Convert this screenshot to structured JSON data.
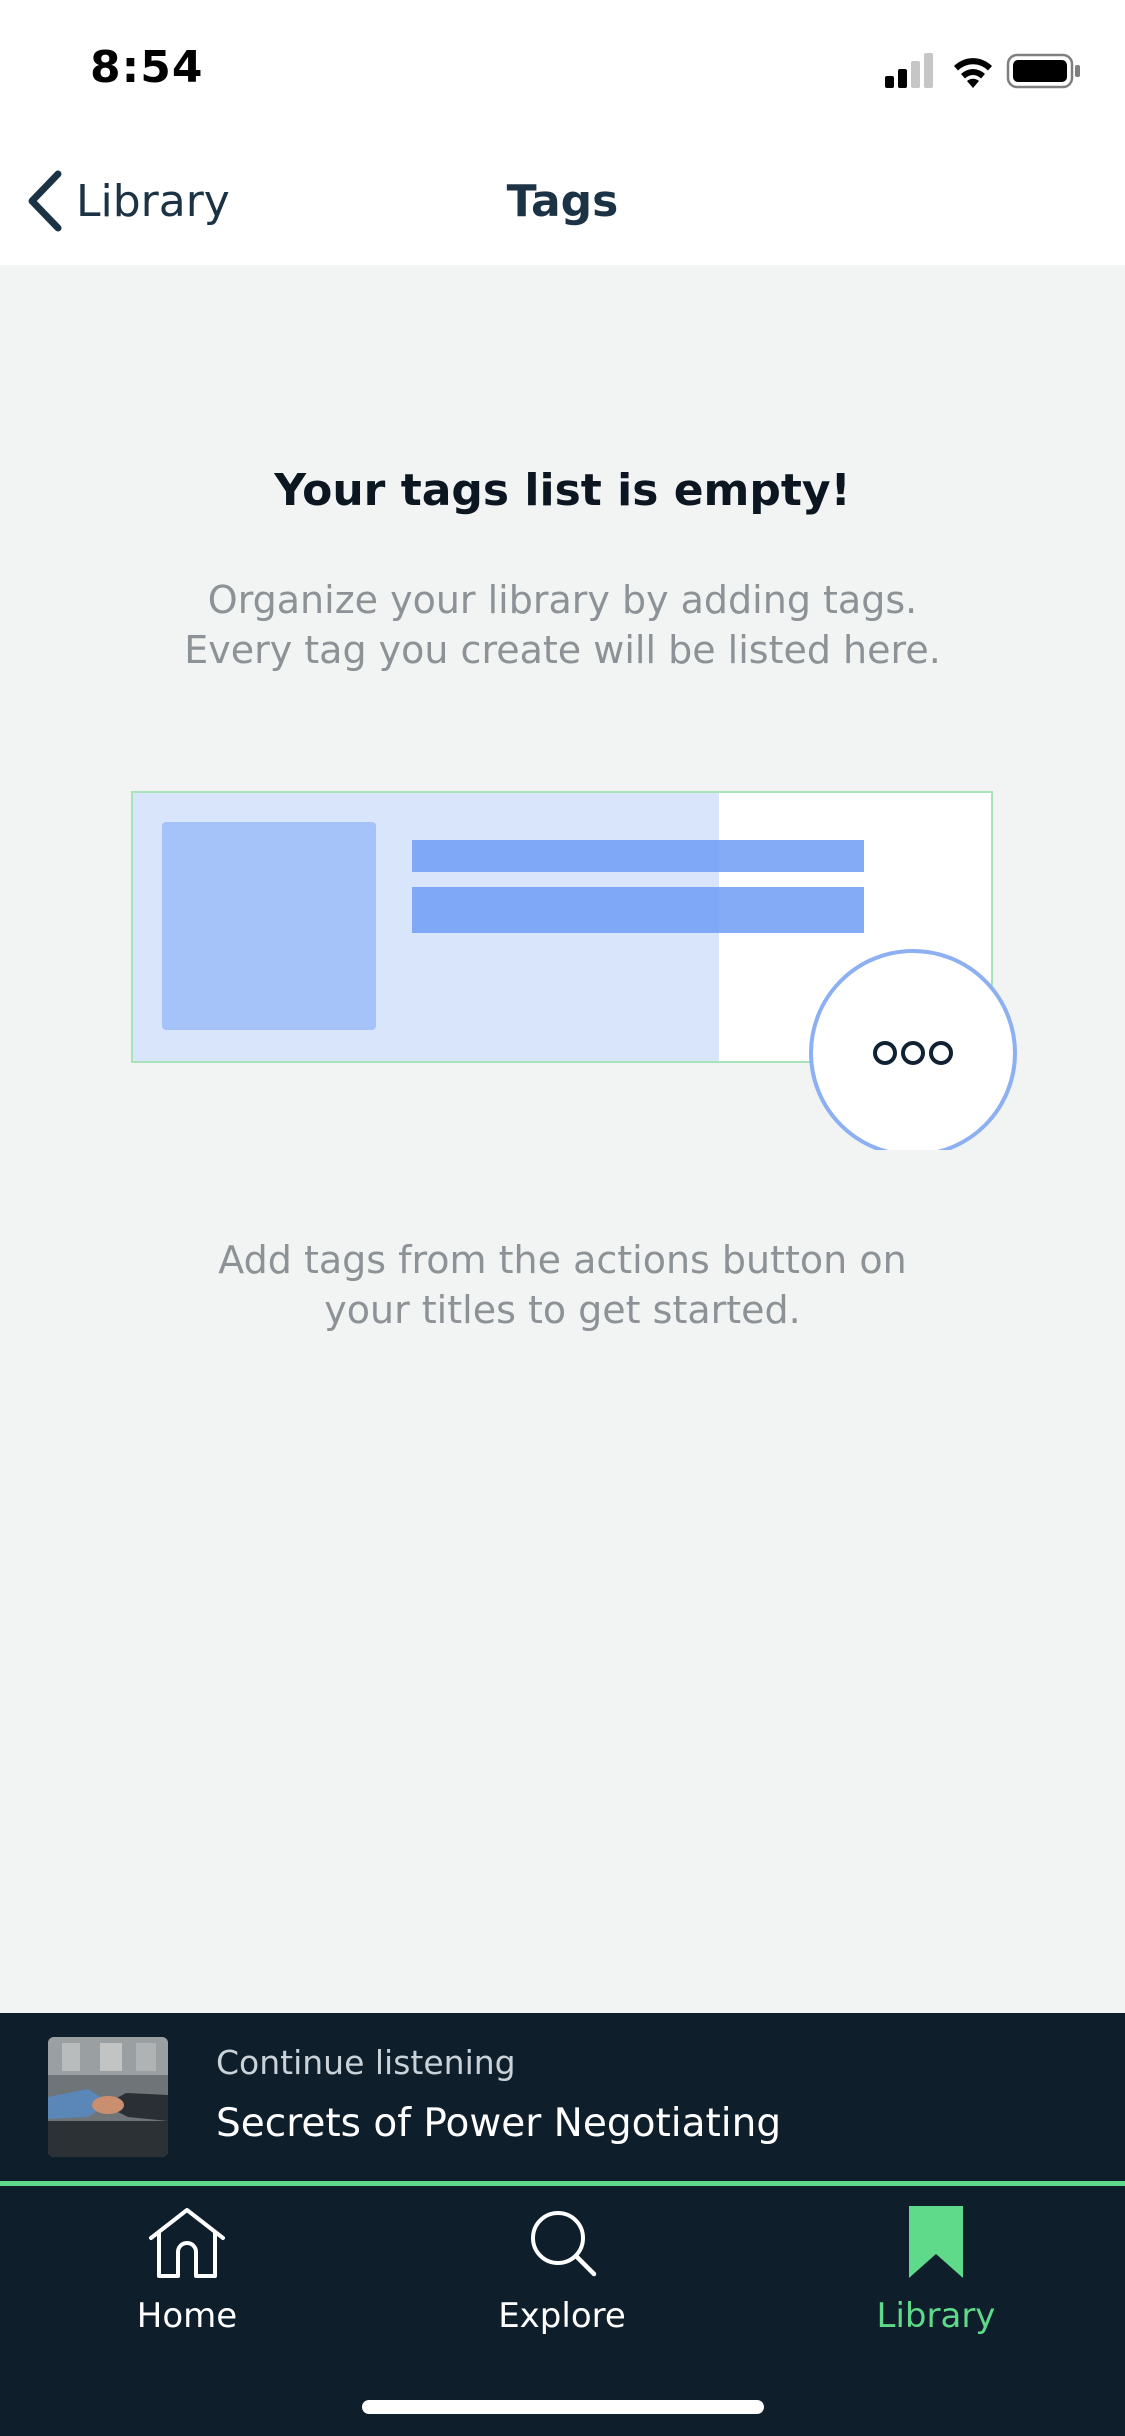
{
  "status_bar": {
    "time": "8:54"
  },
  "nav": {
    "back_label": "Library",
    "title": "Tags"
  },
  "empty_state": {
    "title": "Your tags list is empty!",
    "description_lines": [
      "Organize your library by adding tags.",
      "Every tag you create will be listed here."
    ],
    "hint_lines": [
      "Add tags from the actions button on",
      "your titles to get started."
    ]
  },
  "mini_player": {
    "label": "Continue listening",
    "title": "Secrets of Power Negotiating"
  },
  "tab_bar": {
    "tabs": [
      {
        "label": "Home",
        "icon": "home-icon"
      },
      {
        "label": "Explore",
        "icon": "search-icon"
      },
      {
        "label": "Library",
        "icon": "bookmark-icon",
        "active": true
      }
    ]
  },
  "colors": {
    "accent": "#5fd98a",
    "dark": "#0f1e2b",
    "background": "#f1f4f3",
    "illustration_blue": "#6e9ef5"
  }
}
